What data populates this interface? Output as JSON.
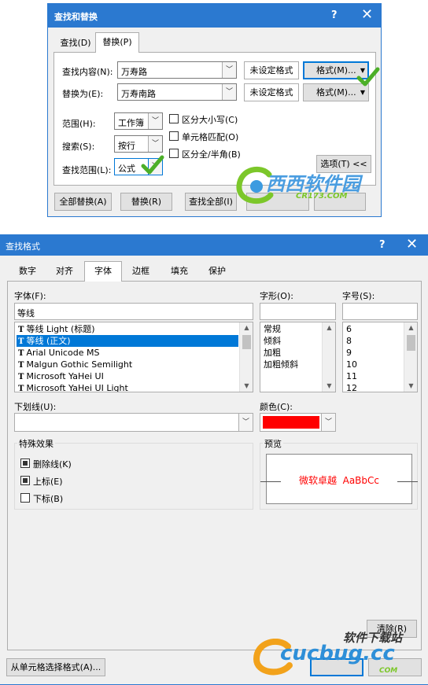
{
  "find_replace": {
    "title": "查找和替换",
    "help_glyph": "?",
    "close_glyph": "✕",
    "tabs": [
      {
        "label": "查找(D)",
        "selected": false
      },
      {
        "label": "替换(P)",
        "selected": true
      }
    ],
    "find_label": "查找内容(N):",
    "find_value": "万寿路",
    "replace_label": "替换为(E):",
    "replace_value": "万寿南路",
    "no_format_1": "未设定格式",
    "no_format_2": "未设定格式",
    "format_btn_1": "格式(M)...",
    "format_btn_2": "格式(M)...",
    "within_label": "范围(H):",
    "within_value": "工作簿",
    "search_label": "搜索(S):",
    "search_value": "按行",
    "lookin_label": "查找范围(L):",
    "lookin_value": "公式",
    "match_case": {
      "label": "区分大小写(C)",
      "checked": false
    },
    "match_entire": {
      "label": "单元格匹配(O)",
      "checked": false
    },
    "match_byte": {
      "label": "区分全/半角(B)",
      "checked": false
    },
    "options_btn": "选项(T) <<",
    "replace_all_btn": "全部替换(A)",
    "replace_btn": "替换(R)",
    "find_all_btn": "查找全部(I)"
  },
  "find_format": {
    "title": "查找格式",
    "help_glyph": "?",
    "close_glyph": "✕",
    "tabs": [
      {
        "label": "数字",
        "selected": false
      },
      {
        "label": "对齐",
        "selected": false
      },
      {
        "label": "字体",
        "selected": true
      },
      {
        "label": "边框",
        "selected": false
      },
      {
        "label": "填充",
        "selected": false
      },
      {
        "label": "保护",
        "selected": false
      }
    ],
    "font_label": "字体(F):",
    "font_value": "等线",
    "font_list": [
      {
        "name": "等线 Light (标题)",
        "selected": false
      },
      {
        "name": "等线 (正文)",
        "selected": true
      },
      {
        "name": "Arial Unicode MS",
        "selected": false
      },
      {
        "name": "Malgun Gothic Semilight",
        "selected": false
      },
      {
        "name": "Microsoft YaHei UI",
        "selected": false
      },
      {
        "name": "Microsoft YaHei UI Light",
        "selected": false
      }
    ],
    "style_label": "字形(O):",
    "style_value": "",
    "style_list": [
      "常规",
      "倾斜",
      "加粗",
      "加粗倾斜"
    ],
    "size_label": "字号(S):",
    "size_value": "",
    "size_list": [
      "6",
      "8",
      "9",
      "10",
      "11",
      "12"
    ],
    "underline_label": "下划线(U):",
    "underline_value": "",
    "color_label": "颜色(C):",
    "color_value": "#ff0000",
    "effects_title": "特殊效果",
    "strikethrough": {
      "label": "删除线(K)",
      "checked": true
    },
    "superscript": {
      "label": "上标(E)",
      "checked": true
    },
    "subscript": {
      "label": "下标(B)",
      "checked": false
    },
    "preview_title": "预览",
    "preview_text": "微软卓越  AaBbCc",
    "preview_color": "#ff0000",
    "clear_btn": "清除(R)",
    "choose_from_cell_btn": "从单元格选择格式(A)..."
  },
  "watermarks": {
    "top": {
      "main": "西西软件园",
      "sub": "CR173.COM"
    },
    "bottom": {
      "main": "软件下载站",
      "brand": "cucbug.cc",
      "sub": "COM"
    }
  },
  "icons": {
    "checkmark_color": "#4caf28",
    "accent": "#2b79d0"
  }
}
